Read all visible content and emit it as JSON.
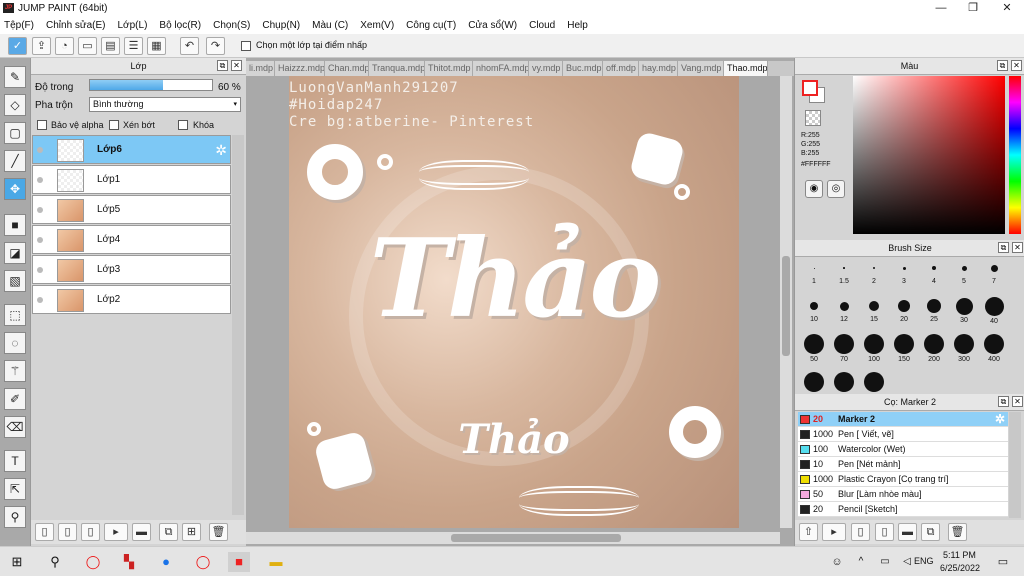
{
  "window": {
    "title": "JUMP PAINT (64bit)"
  },
  "menu": [
    "Tệp(F)",
    "Chỉnh sửa(E)",
    "Lớp(L)",
    "Bộ lọc(R)",
    "Chọn(S)",
    "Chụp(N)",
    "Màu (C)",
    "Xem(V)",
    "Công cụ(T)",
    "Cửa sổ(W)",
    "Cloud",
    "Help"
  ],
  "toolbar": {
    "checkbox_label": "Chọn một lớp tại điểm nhấp"
  },
  "layer_panel": {
    "title": "Lớp",
    "opacity_label": "Độ trong",
    "opacity_value": "60 %",
    "opacity_fraction": 0.6,
    "blend_label": "Pha trộn",
    "blend_value": "Bình thường",
    "protect_alpha": "Bảo vệ alpha",
    "clipping": "Xén bớt",
    "lock": "Khóa",
    "layers": [
      {
        "name": "Lớp6",
        "thumb": "empty",
        "selected": true
      },
      {
        "name": "Lớp1",
        "thumb": "empty",
        "selected": false
      },
      {
        "name": "Lớp5",
        "thumb": "image",
        "selected": false
      },
      {
        "name": "Lớp4",
        "thumb": "image",
        "selected": false
      },
      {
        "name": "Lớp3",
        "thumb": "image",
        "selected": false
      },
      {
        "name": "Lớp2",
        "thumb": "image",
        "selected": false
      }
    ]
  },
  "tabs": [
    "li.mdp",
    "Haizzz.mdp",
    "Chan.mdp",
    "Tranqua.mdp",
    "Thitot.mdp",
    "nhomFA.mdp",
    "vy.mdp",
    "Buc.mdp",
    "off.mdp",
    "hay.mdp",
    "Vang.mdp",
    "Thao.mdp"
  ],
  "active_tab": "Thao.mdp",
  "canvas": {
    "watermark_lines": [
      "LuongVanManh291207",
      "#Hoidap247",
      "Cre bg:atberine- Pinterest"
    ],
    "main_text": "Thảo",
    "sub_text": "Thảo"
  },
  "color_panel": {
    "title": "Màu",
    "r": "R:255",
    "g": "G:255",
    "b": "B:255",
    "hex": "#FFFFFF"
  },
  "brush_size_panel": {
    "title": "Brush Size",
    "sizes": [
      "1",
      "1.5",
      "2",
      "3",
      "4",
      "5",
      "7",
      "10",
      "12",
      "15",
      "20",
      "25",
      "30",
      "40",
      "50",
      "70",
      "100",
      "150",
      "200",
      "300",
      "400"
    ]
  },
  "brush_list": {
    "title": "Cọ: Marker 2",
    "items": [
      {
        "size": "20",
        "name": "Marker 2",
        "color": "#ee3333",
        "selected": true
      },
      {
        "size": "1000",
        "name": "Pen [ Viết, vẽ]",
        "color": "#222222"
      },
      {
        "size": "100",
        "name": "Watercolor (Wet)",
        "color": "#55ddee"
      },
      {
        "size": "10",
        "name": "Pen [Nét mảnh]",
        "color": "#222222"
      },
      {
        "size": "1000",
        "name": "Plastic Crayon [Cọ trang trí]",
        "color": "#eedd00"
      },
      {
        "size": "50",
        "name": "Blur [Làm nhòe màu]",
        "color": "#f4aadd"
      },
      {
        "size": "20",
        "name": "Pencil [Sketch]",
        "color": "#222222"
      }
    ]
  },
  "taskbar": {
    "time": "5:11 PM",
    "date": "6/25/2022",
    "lang": "ENG"
  }
}
